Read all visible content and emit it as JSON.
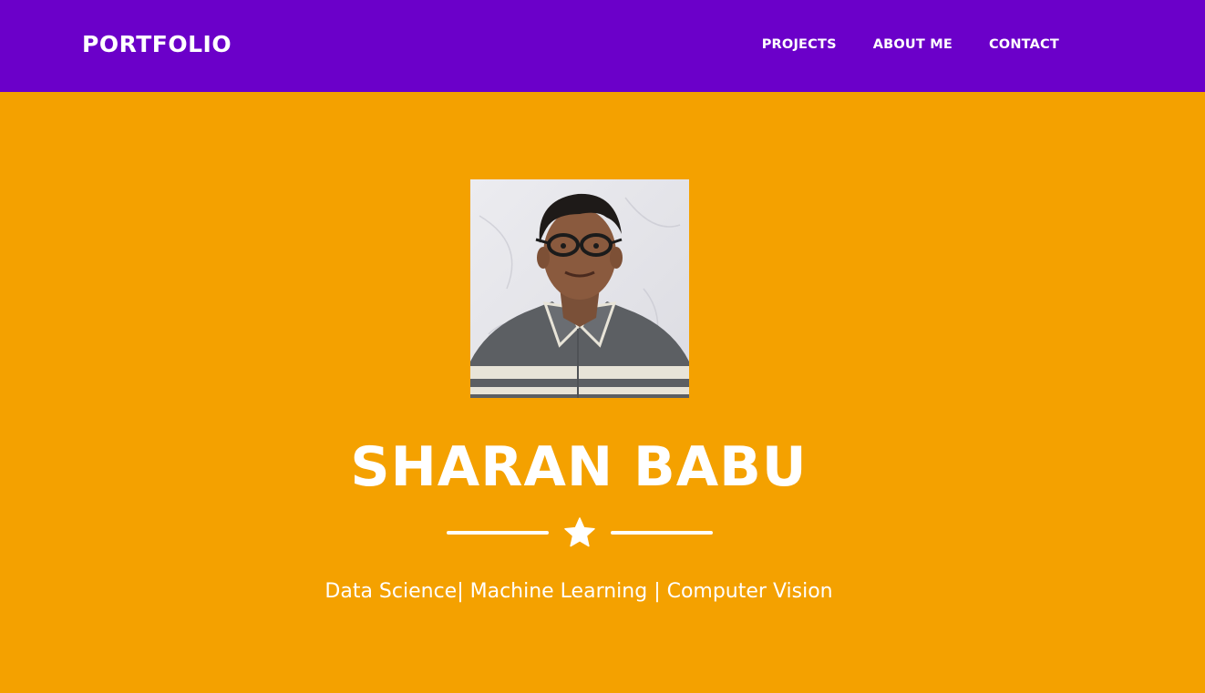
{
  "nav": {
    "brand": "PORTFOLIO",
    "links": [
      "PROJECTS",
      "ABOUT ME",
      "CONTACT"
    ]
  },
  "masthead": {
    "name": "SHARAN BABU",
    "tagline": "Data Science| Machine Learning | Computer Vision",
    "divider_icon": "star-icon",
    "avatar_alt": "avatar"
  },
  "colors": {
    "navbar": "#6b00c9",
    "masthead": "#f4a100",
    "text": "#ffffff"
  }
}
